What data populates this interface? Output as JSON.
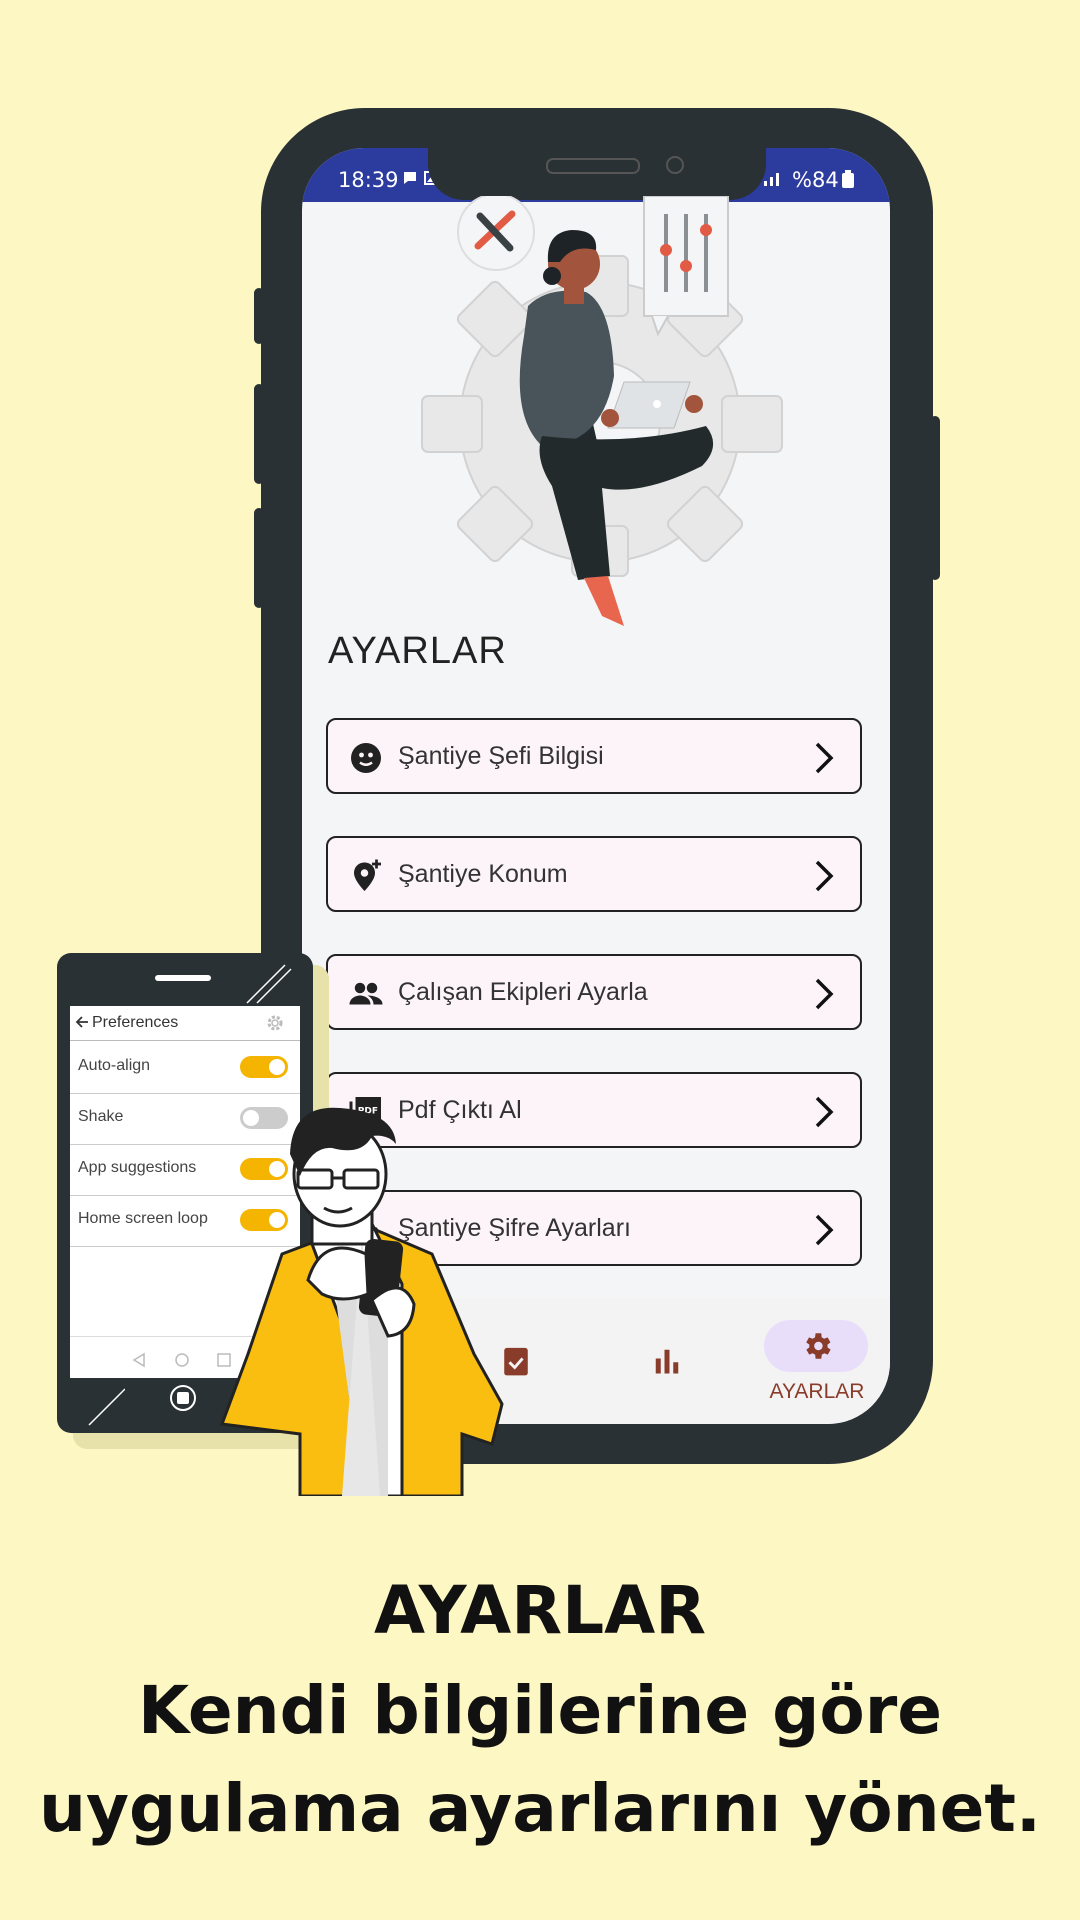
{
  "status_bar": {
    "time": "18:39",
    "battery": "%84"
  },
  "settings_screen": {
    "title": "AYARLAR",
    "menu": [
      {
        "label": "Şantiye Şefi Bilgisi",
        "icon": "face-icon"
      },
      {
        "label": "Şantiye Konum",
        "icon": "add-location-icon"
      },
      {
        "label": "Çalışan Ekipleri Ayarla",
        "icon": "group-icon"
      },
      {
        "label": "Pdf Çıktı Al",
        "icon": "pdf-icon"
      },
      {
        "label": "Şantiye Şifre Ayarları",
        "icon": "lock-icon"
      }
    ]
  },
  "bottom_nav": {
    "items": [
      {
        "icon": "task-icon"
      },
      {
        "icon": "bar-chart-icon"
      },
      {
        "icon": "gear-icon",
        "label": "AYARLAR",
        "active": true
      }
    ]
  },
  "preferences_mockup": {
    "title": "Preferences",
    "rows": [
      {
        "label": "Auto-align",
        "on": true
      },
      {
        "label": "Shake",
        "on": false
      },
      {
        "label": "App suggestions",
        "on": true
      },
      {
        "label": "Home screen loop",
        "on": true
      }
    ]
  },
  "caption": {
    "heading": "AYARLAR",
    "line1": "Kendi bilgilerine göre",
    "line2": "uygulama ayarlarını yönet."
  },
  "colors": {
    "background": "#fdf7c4",
    "status_bar": "#2c3b9e",
    "accent": "#8a3c2a",
    "toggle_on": "#f4b400"
  }
}
